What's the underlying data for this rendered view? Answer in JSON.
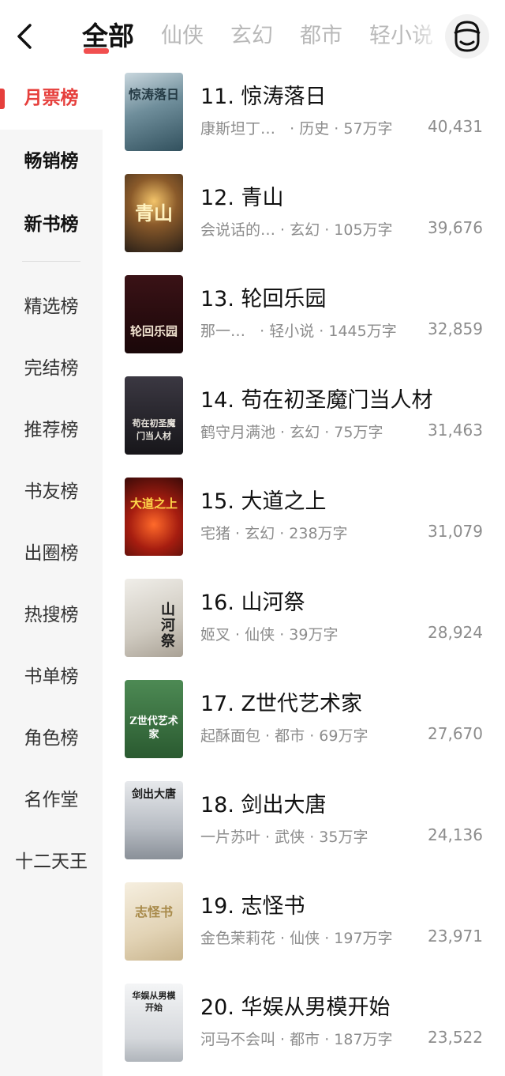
{
  "nav": {
    "tabs": [
      "全部",
      "仙侠",
      "玄幻",
      "都市",
      "轻小说"
    ]
  },
  "sidebar": {
    "items": [
      "月票榜",
      "畅销榜",
      "新书榜",
      "精选榜",
      "完结榜",
      "推荐榜",
      "书友榜",
      "出圈榜",
      "热搜榜",
      "书单榜",
      "角色榜",
      "名作堂",
      "十二天王"
    ]
  },
  "books": [
    {
      "title": "11. 惊涛落日",
      "author": "康斯坦丁…",
      "genre": "历史",
      "words": "57万字",
      "count": "40,431",
      "cover_text": "惊涛落日",
      "cover_color": "#5e7f8f"
    },
    {
      "title": "12. 青山",
      "author": "会说话的…",
      "genre": "玄幻",
      "words": "105万字",
      "count": "39,676",
      "cover_text": "青山",
      "cover_color": "#4a3a2a"
    },
    {
      "title": "13. 轮回乐园",
      "author": "那一…",
      "genre": "轻小说",
      "words": "1445万字",
      "count": "32,859",
      "cover_text": "轮回乐园",
      "cover_color": "#2a0d0f"
    },
    {
      "title": "14. 苟在初圣魔门当人材",
      "author": "鹤守月满池",
      "genre": "玄幻",
      "words": "75万字",
      "count": "31,463",
      "cover_text": "苟在初圣魔门当人材",
      "cover_color": "#1f1c22"
    },
    {
      "title": "15. 大道之上",
      "author": "宅猪",
      "genre": "玄幻",
      "words": "238万字",
      "count": "31,079",
      "cover_text": "大道之上",
      "cover_color": "#7a1810"
    },
    {
      "title": "16. 山河祭",
      "author": "姬叉",
      "genre": "仙侠",
      "words": "39万字",
      "count": "28,924",
      "cover_text": "山河祭",
      "cover_color": "#d8d4cc"
    },
    {
      "title": "17. Z世代艺术家",
      "author": "起酥面包",
      "genre": "都市",
      "words": "69万字",
      "count": "27,670",
      "cover_text": "Z世代艺术家",
      "cover_color": "#2f6b3a"
    },
    {
      "title": "18. 剑出大唐",
      "author": "一片苏叶",
      "genre": "武侠",
      "words": "35万字",
      "count": "24,136",
      "cover_text": "剑出大唐",
      "cover_color": "#c9ccd0"
    },
    {
      "title": "19. 志怪书",
      "author": "金色茉莉花",
      "genre": "仙侠",
      "words": "197万字",
      "count": "23,971",
      "cover_text": "志怪书",
      "cover_color": "#eee3cf"
    },
    {
      "title": "20. 华娱从男模开始",
      "author": "河马不会叫",
      "genre": "都市",
      "words": "187万字",
      "count": "23,522",
      "cover_text": "华娱从男模开始",
      "cover_color": "#e7e8ea"
    }
  ],
  "colors": {
    "accent": "#e63f3c",
    "sidebar_bg": "#f6f6f6"
  },
  "icons": {
    "back": "chevron-left-icon",
    "profile": "avatar-face-icon"
  }
}
